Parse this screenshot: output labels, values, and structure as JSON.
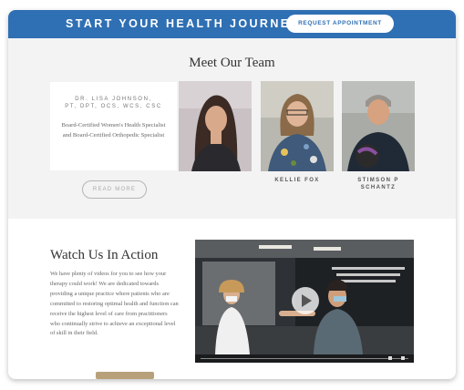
{
  "banner": {
    "title": "START YOUR HEALTH JOURNEY:",
    "button_label": "REQUEST APPOINTMENT",
    "color": "#2f6fb3"
  },
  "team": {
    "title": "Meet Our Team",
    "lead": {
      "name_line1": "DR. LISA JOHNSON,",
      "name_line2": "PT, DPT, OCS, WCS, CSC",
      "description": "Board-Certified Women's Health Specialist and Board-Certified Orthopedic Specialist"
    },
    "members": [
      {
        "name_line1": "KELLIE FOX",
        "name_line2": ""
      },
      {
        "name_line1": "STIMSON P",
        "name_line2": "SCHANTZ"
      }
    ],
    "read_more_label": "READ MORE"
  },
  "action": {
    "title": "Watch Us In Action",
    "body": "We have plenty of videos for you to see how your therapy could work! We are dedicated towards providing a unique practice where patients who are committed to restoring optimal health and function can receive the highest level of care from practitioners who continually strive to achieve an exceptional level of skill in their field."
  },
  "icons": {
    "video_play": "play-icon"
  }
}
